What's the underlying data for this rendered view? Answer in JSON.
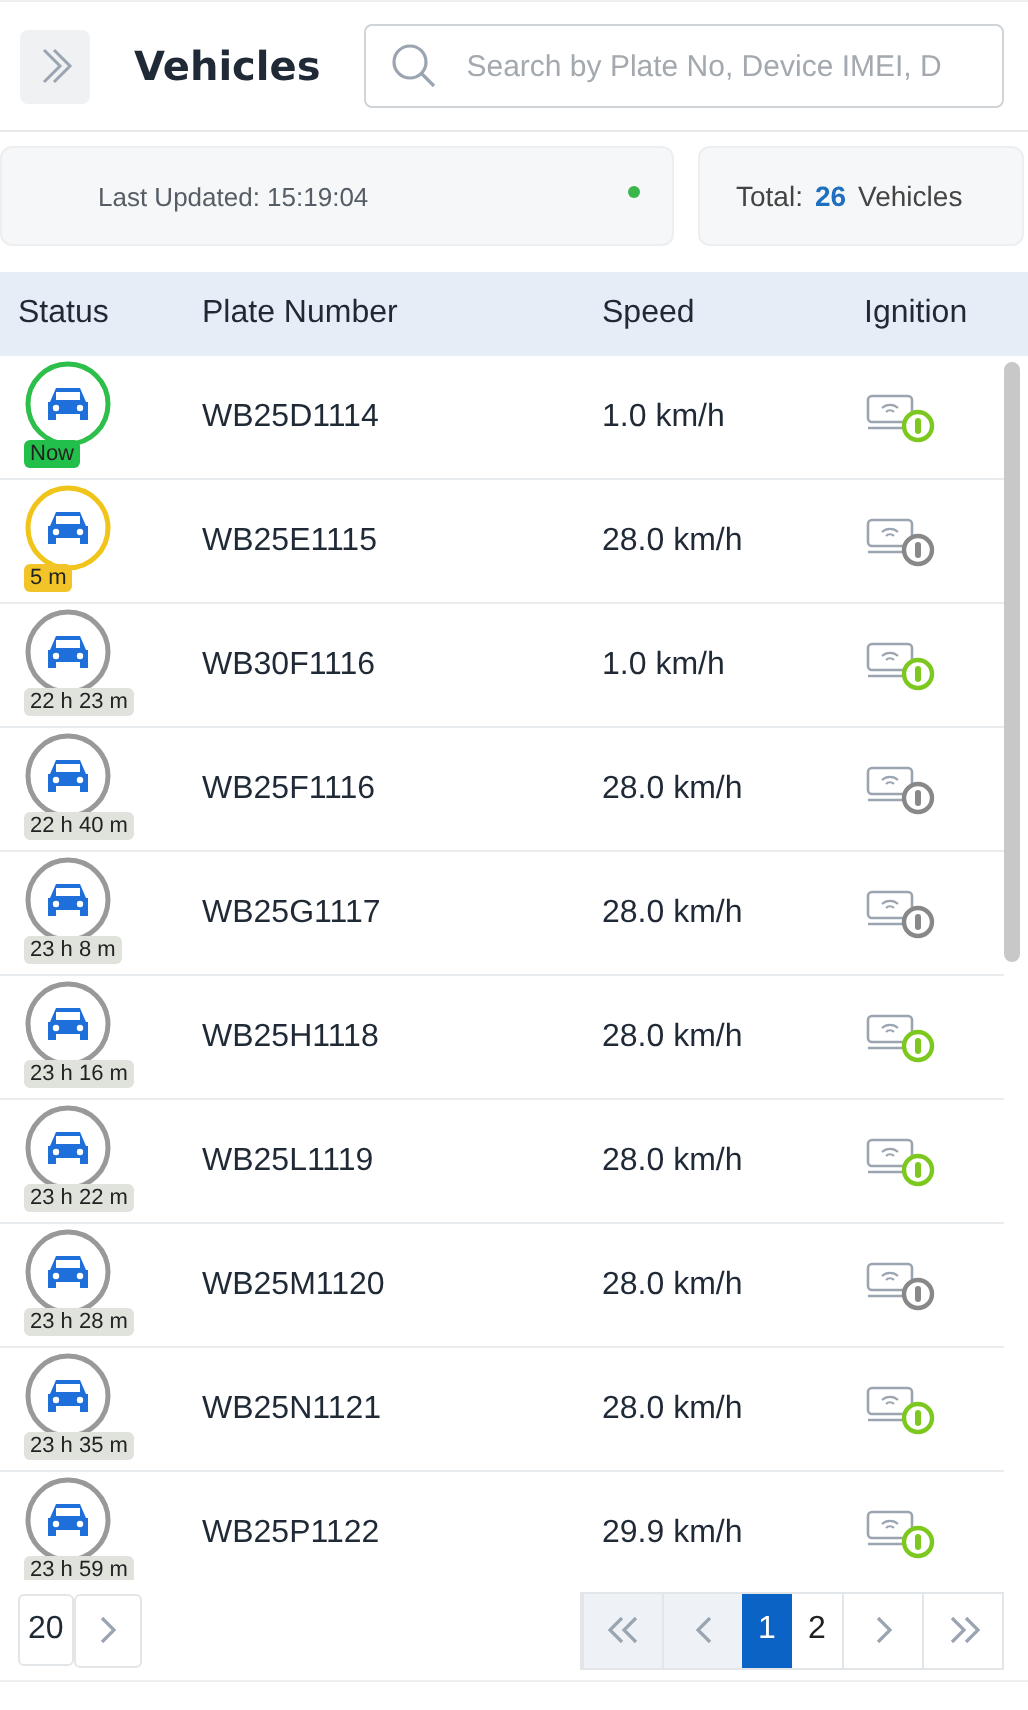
{
  "header": {
    "title": "Vehicles",
    "search": {
      "placeholder": "Search by Plate No, Device IMEI, D"
    }
  },
  "summary": {
    "last_updated": "Last Updated: 15:19:04",
    "live": true,
    "total_label": "Total:",
    "total_count": "26",
    "total_unit": "Vehicles"
  },
  "table": {
    "columns": [
      "Status",
      "Plate Number",
      "Speed",
      "Ignition"
    ],
    "rows": [
      {
        "kind": "now",
        "age": "Now",
        "plate": "WB25D1114",
        "speed": "1.0 km/h",
        "ignition": true
      },
      {
        "kind": "recent",
        "age": "5 m",
        "plate": "WB25E1115",
        "speed": "28.0 km/h",
        "ignition": false
      },
      {
        "kind": "stale",
        "age": "22 h 23 m",
        "plate": "WB30F1116",
        "speed": "1.0 km/h",
        "ignition": true
      },
      {
        "kind": "stale",
        "age": "22 h 40 m",
        "plate": "WB25F1116",
        "speed": "28.0 km/h",
        "ignition": false
      },
      {
        "kind": "stale",
        "age": "23 h 8 m",
        "plate": "WB25G1117",
        "speed": "28.0 km/h",
        "ignition": false
      },
      {
        "kind": "stale",
        "age": "23 h 16 m",
        "plate": "WB25H1118",
        "speed": "28.0 km/h",
        "ignition": true
      },
      {
        "kind": "stale",
        "age": "23 h 22 m",
        "plate": "WB25L1119",
        "speed": "28.0 km/h",
        "ignition": true
      },
      {
        "kind": "stale",
        "age": "23 h 28 m",
        "plate": "WB25M1120",
        "speed": "28.0 km/h",
        "ignition": false
      },
      {
        "kind": "stale",
        "age": "23 h 35 m",
        "plate": "WB25N1121",
        "speed": "28.0 km/h",
        "ignition": true
      },
      {
        "kind": "stale",
        "age": "23 h 59 m",
        "plate": "WB25P1122",
        "speed": "29.9 km/h",
        "ignition": true
      }
    ]
  },
  "footer": {
    "page_size": "20",
    "pages": [
      {
        "label": "1",
        "selected": true
      },
      {
        "label": "2",
        "selected": false
      }
    ]
  }
}
